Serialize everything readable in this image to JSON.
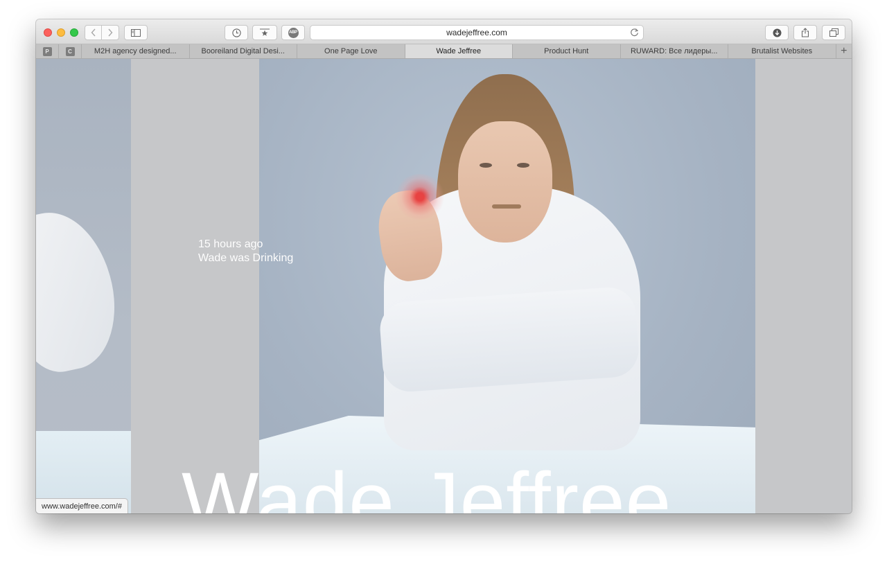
{
  "browser": {
    "url": "wadejeffree.com",
    "status_url": "www.wadejeffree.com/#",
    "pinned_tabs": [
      "P",
      "C"
    ],
    "tabs": [
      {
        "label": "M2H agency designed...",
        "active": false
      },
      {
        "label": "Booreiland Digital Desi...",
        "active": false
      },
      {
        "label": "One Page Love",
        "active": false
      },
      {
        "label": "Wade Jeffree",
        "active": true
      },
      {
        "label": "Product Hunt",
        "active": false
      },
      {
        "label": "RUWARD: Все лидеры...",
        "active": false
      },
      {
        "label": "Brutalist Websites",
        "active": false
      }
    ],
    "abp_label": "ABP",
    "new_tab_glyph": "+"
  },
  "page": {
    "time_ago": "15 hours ago",
    "activity": "Wade was Drinking",
    "hero_title": "Wade Jeffree"
  },
  "icons": {
    "back": "chevron-left-icon",
    "forward": "chevron-right-icon",
    "sidebar": "sidebar-icon",
    "history": "clock-icon",
    "bookmarks": "star-icon",
    "reload": "reload-icon",
    "downloads": "download-icon",
    "share": "share-icon",
    "tabs_overview": "tabs-icon"
  },
  "colors": {
    "close": "#fc605c",
    "minimize": "#fdbc40",
    "zoom": "#34c84a",
    "photo_bg": "#a6b3c3",
    "gray_panel": "#c6c7c9"
  }
}
